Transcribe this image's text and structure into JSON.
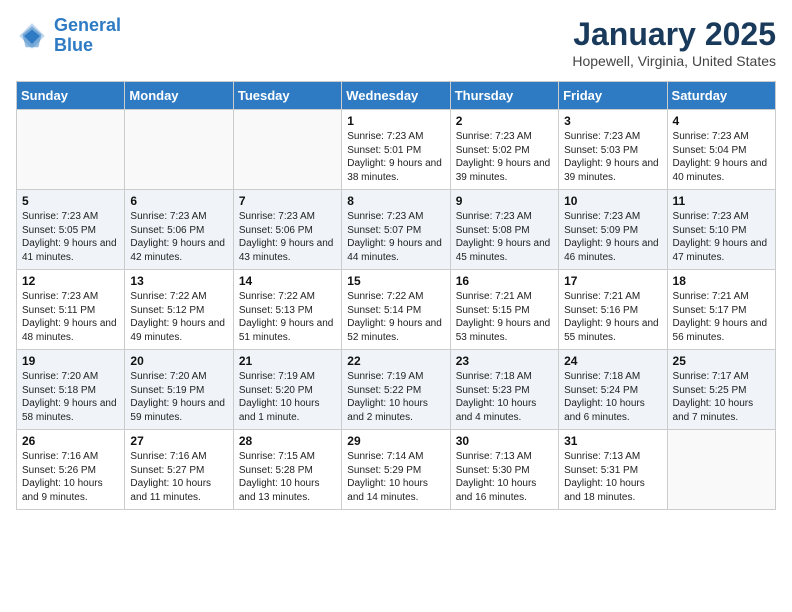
{
  "header": {
    "logo_line1": "General",
    "logo_line2": "Blue",
    "month": "January 2025",
    "location": "Hopewell, Virginia, United States"
  },
  "weekdays": [
    "Sunday",
    "Monday",
    "Tuesday",
    "Wednesday",
    "Thursday",
    "Friday",
    "Saturday"
  ],
  "weeks": [
    [
      {
        "day": "",
        "content": ""
      },
      {
        "day": "",
        "content": ""
      },
      {
        "day": "",
        "content": ""
      },
      {
        "day": "1",
        "content": "Sunrise: 7:23 AM\nSunset: 5:01 PM\nDaylight: 9 hours and 38 minutes."
      },
      {
        "day": "2",
        "content": "Sunrise: 7:23 AM\nSunset: 5:02 PM\nDaylight: 9 hours and 39 minutes."
      },
      {
        "day": "3",
        "content": "Sunrise: 7:23 AM\nSunset: 5:03 PM\nDaylight: 9 hours and 39 minutes."
      },
      {
        "day": "4",
        "content": "Sunrise: 7:23 AM\nSunset: 5:04 PM\nDaylight: 9 hours and 40 minutes."
      }
    ],
    [
      {
        "day": "5",
        "content": "Sunrise: 7:23 AM\nSunset: 5:05 PM\nDaylight: 9 hours and 41 minutes."
      },
      {
        "day": "6",
        "content": "Sunrise: 7:23 AM\nSunset: 5:06 PM\nDaylight: 9 hours and 42 minutes."
      },
      {
        "day": "7",
        "content": "Sunrise: 7:23 AM\nSunset: 5:06 PM\nDaylight: 9 hours and 43 minutes."
      },
      {
        "day": "8",
        "content": "Sunrise: 7:23 AM\nSunset: 5:07 PM\nDaylight: 9 hours and 44 minutes."
      },
      {
        "day": "9",
        "content": "Sunrise: 7:23 AM\nSunset: 5:08 PM\nDaylight: 9 hours and 45 minutes."
      },
      {
        "day": "10",
        "content": "Sunrise: 7:23 AM\nSunset: 5:09 PM\nDaylight: 9 hours and 46 minutes."
      },
      {
        "day": "11",
        "content": "Sunrise: 7:23 AM\nSunset: 5:10 PM\nDaylight: 9 hours and 47 minutes."
      }
    ],
    [
      {
        "day": "12",
        "content": "Sunrise: 7:23 AM\nSunset: 5:11 PM\nDaylight: 9 hours and 48 minutes."
      },
      {
        "day": "13",
        "content": "Sunrise: 7:22 AM\nSunset: 5:12 PM\nDaylight: 9 hours and 49 minutes."
      },
      {
        "day": "14",
        "content": "Sunrise: 7:22 AM\nSunset: 5:13 PM\nDaylight: 9 hours and 51 minutes."
      },
      {
        "day": "15",
        "content": "Sunrise: 7:22 AM\nSunset: 5:14 PM\nDaylight: 9 hours and 52 minutes."
      },
      {
        "day": "16",
        "content": "Sunrise: 7:21 AM\nSunset: 5:15 PM\nDaylight: 9 hours and 53 minutes."
      },
      {
        "day": "17",
        "content": "Sunrise: 7:21 AM\nSunset: 5:16 PM\nDaylight: 9 hours and 55 minutes."
      },
      {
        "day": "18",
        "content": "Sunrise: 7:21 AM\nSunset: 5:17 PM\nDaylight: 9 hours and 56 minutes."
      }
    ],
    [
      {
        "day": "19",
        "content": "Sunrise: 7:20 AM\nSunset: 5:18 PM\nDaylight: 9 hours and 58 minutes."
      },
      {
        "day": "20",
        "content": "Sunrise: 7:20 AM\nSunset: 5:19 PM\nDaylight: 9 hours and 59 minutes."
      },
      {
        "day": "21",
        "content": "Sunrise: 7:19 AM\nSunset: 5:20 PM\nDaylight: 10 hours and 1 minute."
      },
      {
        "day": "22",
        "content": "Sunrise: 7:19 AM\nSunset: 5:22 PM\nDaylight: 10 hours and 2 minutes."
      },
      {
        "day": "23",
        "content": "Sunrise: 7:18 AM\nSunset: 5:23 PM\nDaylight: 10 hours and 4 minutes."
      },
      {
        "day": "24",
        "content": "Sunrise: 7:18 AM\nSunset: 5:24 PM\nDaylight: 10 hours and 6 minutes."
      },
      {
        "day": "25",
        "content": "Sunrise: 7:17 AM\nSunset: 5:25 PM\nDaylight: 10 hours and 7 minutes."
      }
    ],
    [
      {
        "day": "26",
        "content": "Sunrise: 7:16 AM\nSunset: 5:26 PM\nDaylight: 10 hours and 9 minutes."
      },
      {
        "day": "27",
        "content": "Sunrise: 7:16 AM\nSunset: 5:27 PM\nDaylight: 10 hours and 11 minutes."
      },
      {
        "day": "28",
        "content": "Sunrise: 7:15 AM\nSunset: 5:28 PM\nDaylight: 10 hours and 13 minutes."
      },
      {
        "day": "29",
        "content": "Sunrise: 7:14 AM\nSunset: 5:29 PM\nDaylight: 10 hours and 14 minutes."
      },
      {
        "day": "30",
        "content": "Sunrise: 7:13 AM\nSunset: 5:30 PM\nDaylight: 10 hours and 16 minutes."
      },
      {
        "day": "31",
        "content": "Sunrise: 7:13 AM\nSunset: 5:31 PM\nDaylight: 10 hours and 18 minutes."
      },
      {
        "day": "",
        "content": ""
      }
    ]
  ]
}
